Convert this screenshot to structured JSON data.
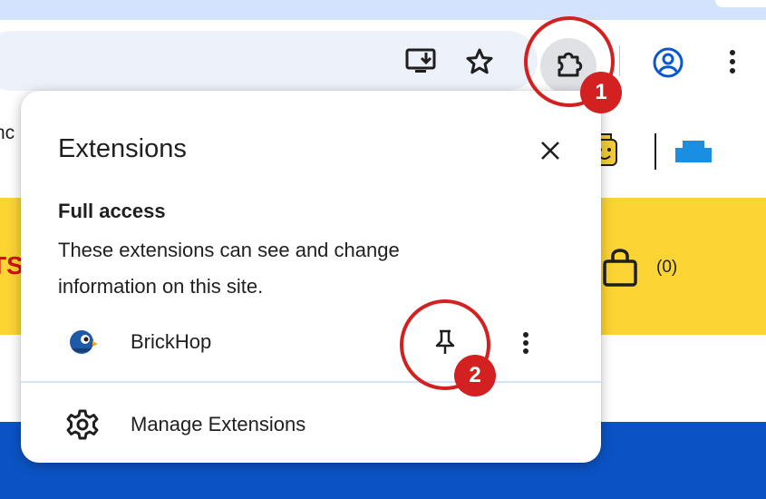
{
  "page": {
    "cut_text": "nc",
    "red_cut_text": "TS",
    "cart_count": "(0)"
  },
  "toolbar": {
    "icons": [
      "install-app-icon",
      "bookmark-star-icon",
      "extensions-puzzle-icon",
      "profile-icon",
      "more-menu-icon"
    ]
  },
  "popup": {
    "title": "Extensions",
    "section_title": "Full access",
    "section_description": "These extensions can see and change information on this site.",
    "extensions": [
      {
        "name": "BrickHop",
        "icon": "bird-logo-icon"
      }
    ],
    "manage_label": "Manage Extensions"
  },
  "annotations": [
    {
      "label": "1",
      "target": "extensions button"
    },
    {
      "label": "2",
      "target": "pin button"
    }
  ],
  "colors": {
    "annotation_red": "#d32020",
    "page_yellow": "#fcd434",
    "page_blue": "#0b53c5",
    "tabstrip": "#d3e3fd",
    "omnibox": "#edf2fa",
    "accent_blue": "#0b57d0"
  }
}
